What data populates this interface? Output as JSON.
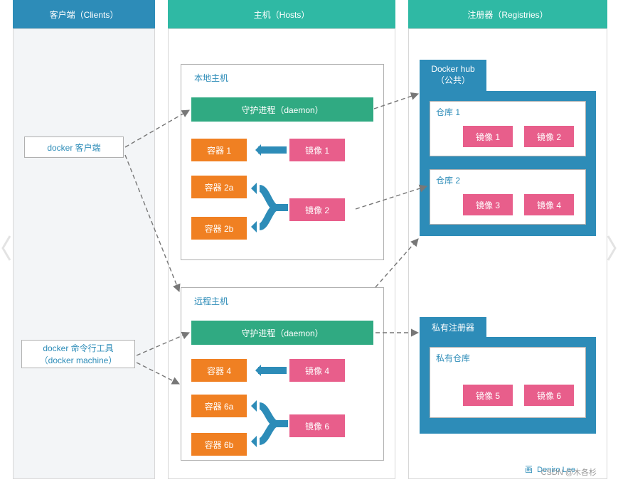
{
  "columns": {
    "clients": "客户端（Clients）",
    "hosts": "主机（Hosts）",
    "registries": "注册器（Registries）"
  },
  "clients": {
    "docker_client": "docker 客户端",
    "docker_cli_line1": "docker 命令行工具",
    "docker_cli_line2": "（docker machine）"
  },
  "local_host": {
    "title": "本地主机",
    "daemon": "守护进程（daemon）",
    "containers": {
      "c1": "容器 1",
      "c2a": "容器 2a",
      "c2b": "容器 2b"
    },
    "images": {
      "i1": "镜像 1",
      "i2": "镜像 2"
    }
  },
  "remote_host": {
    "title": "远程主机",
    "daemon": "守护进程（daemon）",
    "containers": {
      "c4": "容器 4",
      "c6a": "容器 6a",
      "c6b": "容器 6b"
    },
    "images": {
      "i4": "镜像 4",
      "i6": "镜像 6"
    }
  },
  "docker_hub": {
    "title_line1": "Docker hub",
    "title_line2": "（公共）",
    "repo1": {
      "title": "仓库 1",
      "img1": "镜像 1",
      "img2": "镜像 2"
    },
    "repo2": {
      "title": "仓库 2",
      "img3": "镜像 3",
      "img4": "镜像 4"
    }
  },
  "private_registry": {
    "title": "私有注册器",
    "repo": {
      "title": "私有仓库",
      "img5": "镜像 5",
      "img6": "镜像 6"
    }
  },
  "credit_prefix": "画",
  "credit_name": "Deniro Lee",
  "watermark": "CSDN @木各杉"
}
